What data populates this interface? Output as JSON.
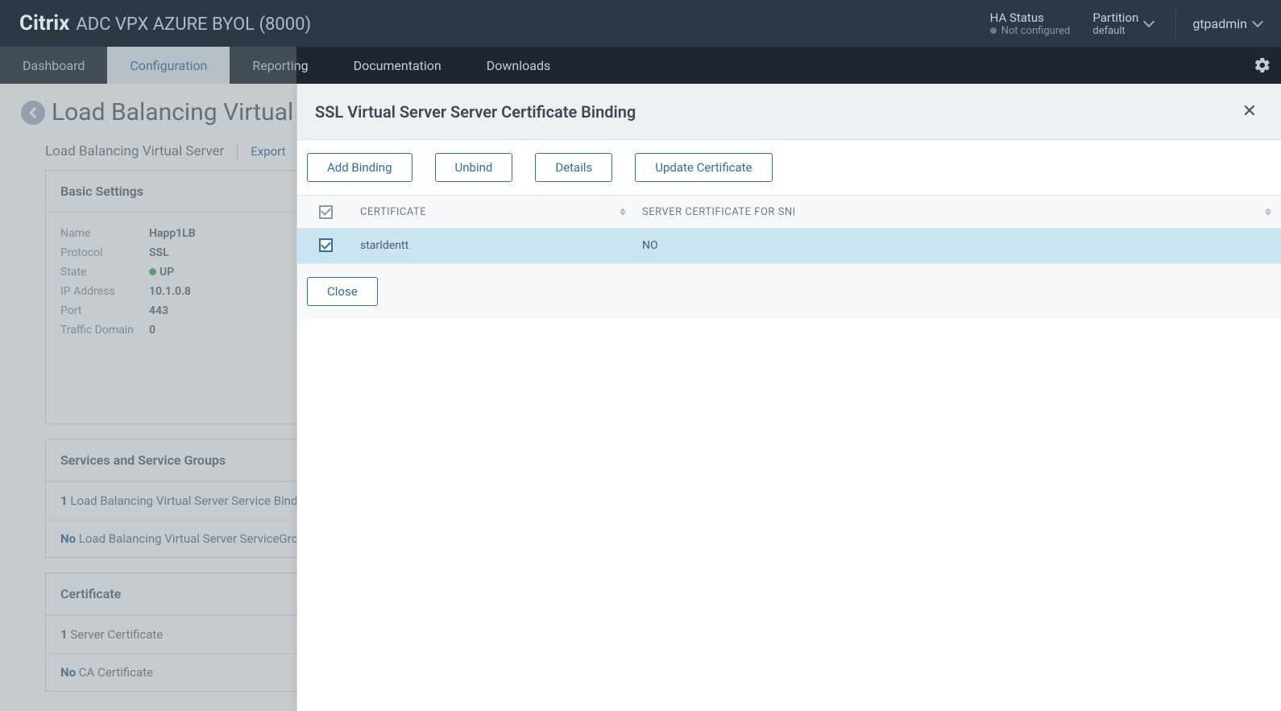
{
  "header": {
    "brand_main": "Citrix",
    "brand_sub": "ADC VPX AZURE BYOL (8000)",
    "ha_title": "HA Status",
    "ha_value": "Not configured",
    "partition_label": "Partition",
    "partition_value": "default",
    "user": "gtpadmin"
  },
  "nav": {
    "tabs": [
      {
        "label": "Dashboard",
        "active": false
      },
      {
        "label": "Configuration",
        "active": true
      },
      {
        "label": "Reporting",
        "active": false
      },
      {
        "label": "Documentation",
        "active": false
      },
      {
        "label": "Downloads",
        "active": false
      }
    ]
  },
  "background": {
    "page_title": "Load Balancing Virtual",
    "sub_label": "Load Balancing Virtual Server",
    "export": "Export",
    "basic_settings_title": "Basic Settings",
    "fields": {
      "name_label": "Name",
      "name_value": "Happ1LB",
      "protocol_label": "Protocol",
      "protocol_value": "SSL",
      "state_label": "State",
      "state_value": "UP",
      "ip_label": "IP Address",
      "ip_value": "10.1.0.8",
      "port_label": "Port",
      "port_value": "443",
      "traffic_label": "Traffic Domain",
      "traffic_value": "0"
    },
    "services_title": "Services and Service Groups",
    "service_binding_count": "1",
    "service_binding_text": " Load Balancing Virtual Server Service Bindi",
    "servicegroup_no": "No",
    "servicegroup_text": " Load Balancing Virtual Server ServiceGrou",
    "certificate_title": "Certificate",
    "server_cert_count": "1",
    "server_cert_text": " Server Certificate",
    "ca_cert_no": "No",
    "ca_cert_text": " CA Certificate"
  },
  "panel": {
    "title": "SSL Virtual Server Server Certificate Binding",
    "buttons": {
      "add": "Add Binding",
      "unbind": "Unbind",
      "details": "Details",
      "update": "Update Certificate",
      "close": "Close"
    },
    "columns": {
      "certificate": "CERTIFICATE",
      "sni": "SERVER CERTIFICATE FOR SNI"
    },
    "rows": [
      {
        "certificate": "starIdentt",
        "sni": "NO",
        "checked": true
      }
    ]
  }
}
